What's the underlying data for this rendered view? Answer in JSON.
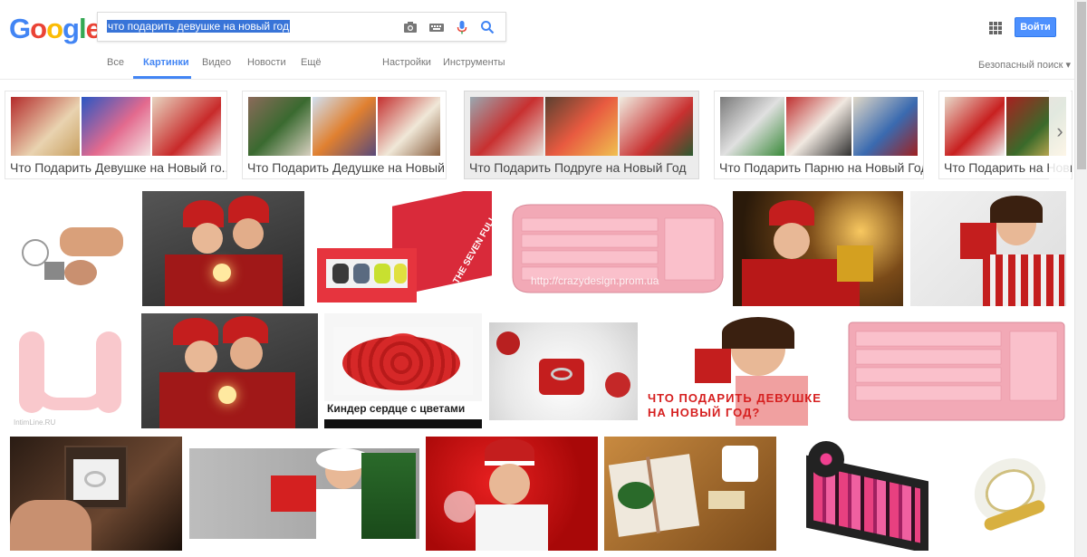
{
  "logo": {
    "letters": [
      "G",
      "o",
      "o",
      "g",
      "l",
      "e"
    ]
  },
  "search": {
    "query": "что подарить девушке на новый год"
  },
  "header": {
    "signin_label": "Войти",
    "safe_search_label": "Безопасный поиск ▾"
  },
  "tabs": [
    {
      "label": "Все"
    },
    {
      "label": "Картинки"
    },
    {
      "label": "Видео"
    },
    {
      "label": "Новости"
    },
    {
      "label": "Ещё"
    },
    {
      "label": "Настройки"
    },
    {
      "label": "Инструменты"
    }
  ],
  "related": [
    {
      "label": "Что Подарить Девушке на Новый го..."
    },
    {
      "label": "Что Подарить Дедушке на Новый..."
    },
    {
      "label": "Что Подарить Подруге на Новый Год"
    },
    {
      "label": "Что Подарить Парню на Новый Год"
    },
    {
      "label": "Что Подарить на Новый"
    }
  ],
  "image_captions": {
    "site1": "http://crazydesign.prom.ua",
    "kinder": "Киндер сердце с цветами",
    "promo_line1": "ЧТО ПОДАРИТЬ ДЕВУШКЕ",
    "promo_line2": "НА НОВЫЙ ГОД?",
    "intim": "IntimLine.RU",
    "book": "THE SEVEN FULL COLLECTION"
  },
  "colors": {
    "accent": "#4285f4",
    "signin": "#4d90fe"
  }
}
